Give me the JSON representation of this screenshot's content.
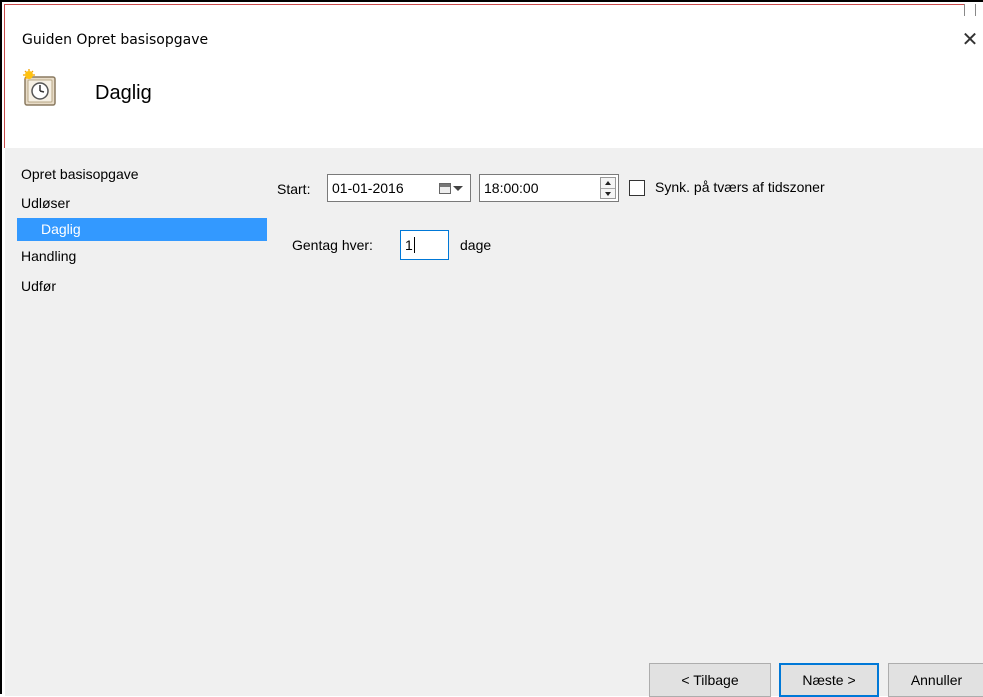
{
  "window": {
    "title": "Guiden Opret basisopgave",
    "close_glyph": "✕"
  },
  "header": {
    "title": "Daglig",
    "icon": "clock-sun-icon"
  },
  "nav": {
    "items": [
      {
        "label": "Opret basisopgave"
      },
      {
        "label": "Udløser"
      },
      {
        "label": "Daglig"
      },
      {
        "label": "Handling"
      },
      {
        "label": "Udfør"
      }
    ]
  },
  "form": {
    "start_label": "Start:",
    "start_date": "01-01-2016",
    "start_time": "18:00:00",
    "sync_label": "Synk. på tværs af tidszoner",
    "sync_checked": false,
    "repeat_label": "Gentag hver:",
    "repeat_value": "1",
    "repeat_unit": "dage"
  },
  "buttons": {
    "back": "< Tilbage",
    "next": "Næste >",
    "cancel": "Annuller"
  },
  "colors": {
    "selection": "#3399ff",
    "focus": "#0078d7"
  }
}
